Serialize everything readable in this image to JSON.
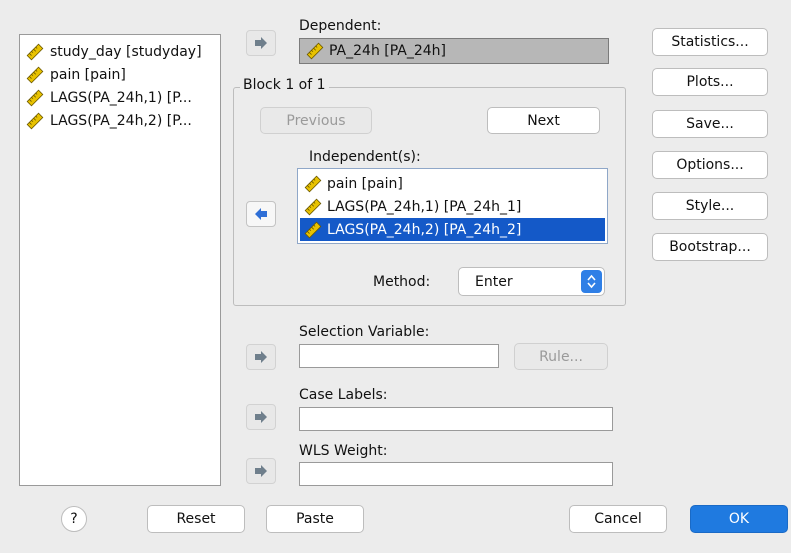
{
  "source_variables": [
    {
      "label": "study_day [studyday]",
      "icon": "ruler-icon"
    },
    {
      "label": "pain [pain]",
      "icon": "ruler-icon"
    },
    {
      "label": "LAGS(PA_24h,1) [P...",
      "icon": "ruler-icon"
    },
    {
      "label": "LAGS(PA_24h,2) [P...",
      "icon": "ruler-icon"
    }
  ],
  "dependent": {
    "label": "Dependent:",
    "value": "PA_24h [PA_24h]"
  },
  "block": {
    "title": "Block 1 of 1",
    "previous_label": "Previous",
    "next_label": "Next"
  },
  "independents": {
    "label": "Independent(s):",
    "items": [
      {
        "label": "pain [pain]",
        "selected": false
      },
      {
        "label": "LAGS(PA_24h,1) [PA_24h_1]",
        "selected": false
      },
      {
        "label": "LAGS(PA_24h,2) [PA_24h_2]",
        "selected": true
      }
    ]
  },
  "method": {
    "label": "Method:",
    "value": "Enter"
  },
  "selection_variable": {
    "label": "Selection Variable:",
    "value": "",
    "rule_label": "Rule..."
  },
  "case_labels": {
    "label": "Case Labels:",
    "value": ""
  },
  "wls_weight": {
    "label": "WLS Weight:",
    "value": ""
  },
  "side_buttons": [
    "Statistics...",
    "Plots...",
    "Save...",
    "Options...",
    "Style...",
    "Bootstrap..."
  ],
  "footer": {
    "help_label": "?",
    "reset_label": "Reset",
    "paste_label": "Paste",
    "cancel_label": "Cancel",
    "ok_label": "OK"
  },
  "colors": {
    "selection": "#1459c8",
    "primary_button": "#1f7ae0",
    "arrow_blue": "#2f6fd6",
    "arrow_gray": "#6f7f8c",
    "ruler_yellow": "#e8c200"
  }
}
